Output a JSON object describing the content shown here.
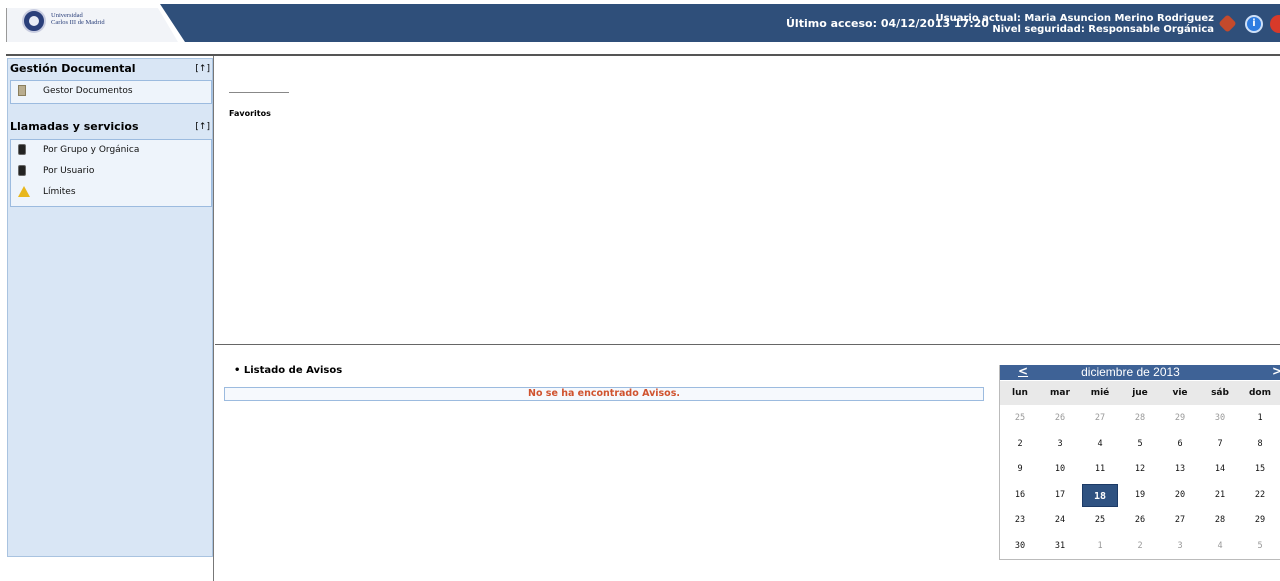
{
  "header": {
    "logo_line1": "Universidad",
    "logo_line2": "Carlos III de Madrid",
    "last_access": "Último acceso: 04/12/2013 17:20",
    "current_user": "Usuario actual: Maria Asuncion Merino Rodriguez",
    "security_level": "Nivel seguridad: Responsable Orgánica",
    "icons": [
      "mail-icon",
      "info-icon",
      "exit-icon"
    ]
  },
  "sidebar": {
    "sections": [
      {
        "title": "Gestión Documental",
        "toggle": "[↑]",
        "items": [
          {
            "label": "Gestor Documentos",
            "icon": "document-icon"
          }
        ]
      },
      {
        "title": "Llamadas y servicios",
        "toggle": "[↑]",
        "items": [
          {
            "label": "Por Grupo y Orgánica",
            "icon": "phone-icon"
          },
          {
            "label": "Por Usuario",
            "icon": "phone-icon"
          },
          {
            "label": "Límites",
            "icon": "warning-icon"
          }
        ]
      }
    ]
  },
  "main": {
    "favorites_label": "Favoritos",
    "notices_title": "• Listado de Avisos",
    "notices_empty": "No se ha encontrado Avisos."
  },
  "calendar": {
    "prev": "<",
    "title": "diciembre de 2013",
    "next": ">",
    "weekdays": [
      "lun",
      "mar",
      "mié",
      "jue",
      "vie",
      "sáb",
      "dom"
    ],
    "weeks": [
      [
        "25",
        "26",
        "27",
        "28",
        "29",
        "30",
        "1"
      ],
      [
        "2",
        "3",
        "4",
        "5",
        "6",
        "7",
        "8"
      ],
      [
        "9",
        "10",
        "11",
        "12",
        "13",
        "14",
        "15"
      ],
      [
        "16",
        "17",
        "18",
        "19",
        "20",
        "21",
        "22"
      ],
      [
        "23",
        "24",
        "25",
        "26",
        "27",
        "28",
        "29"
      ],
      [
        "30",
        "31",
        "1",
        "2",
        "3",
        "4",
        "5"
      ]
    ],
    "selected_day": "18",
    "accent_color": "#3e6296"
  }
}
